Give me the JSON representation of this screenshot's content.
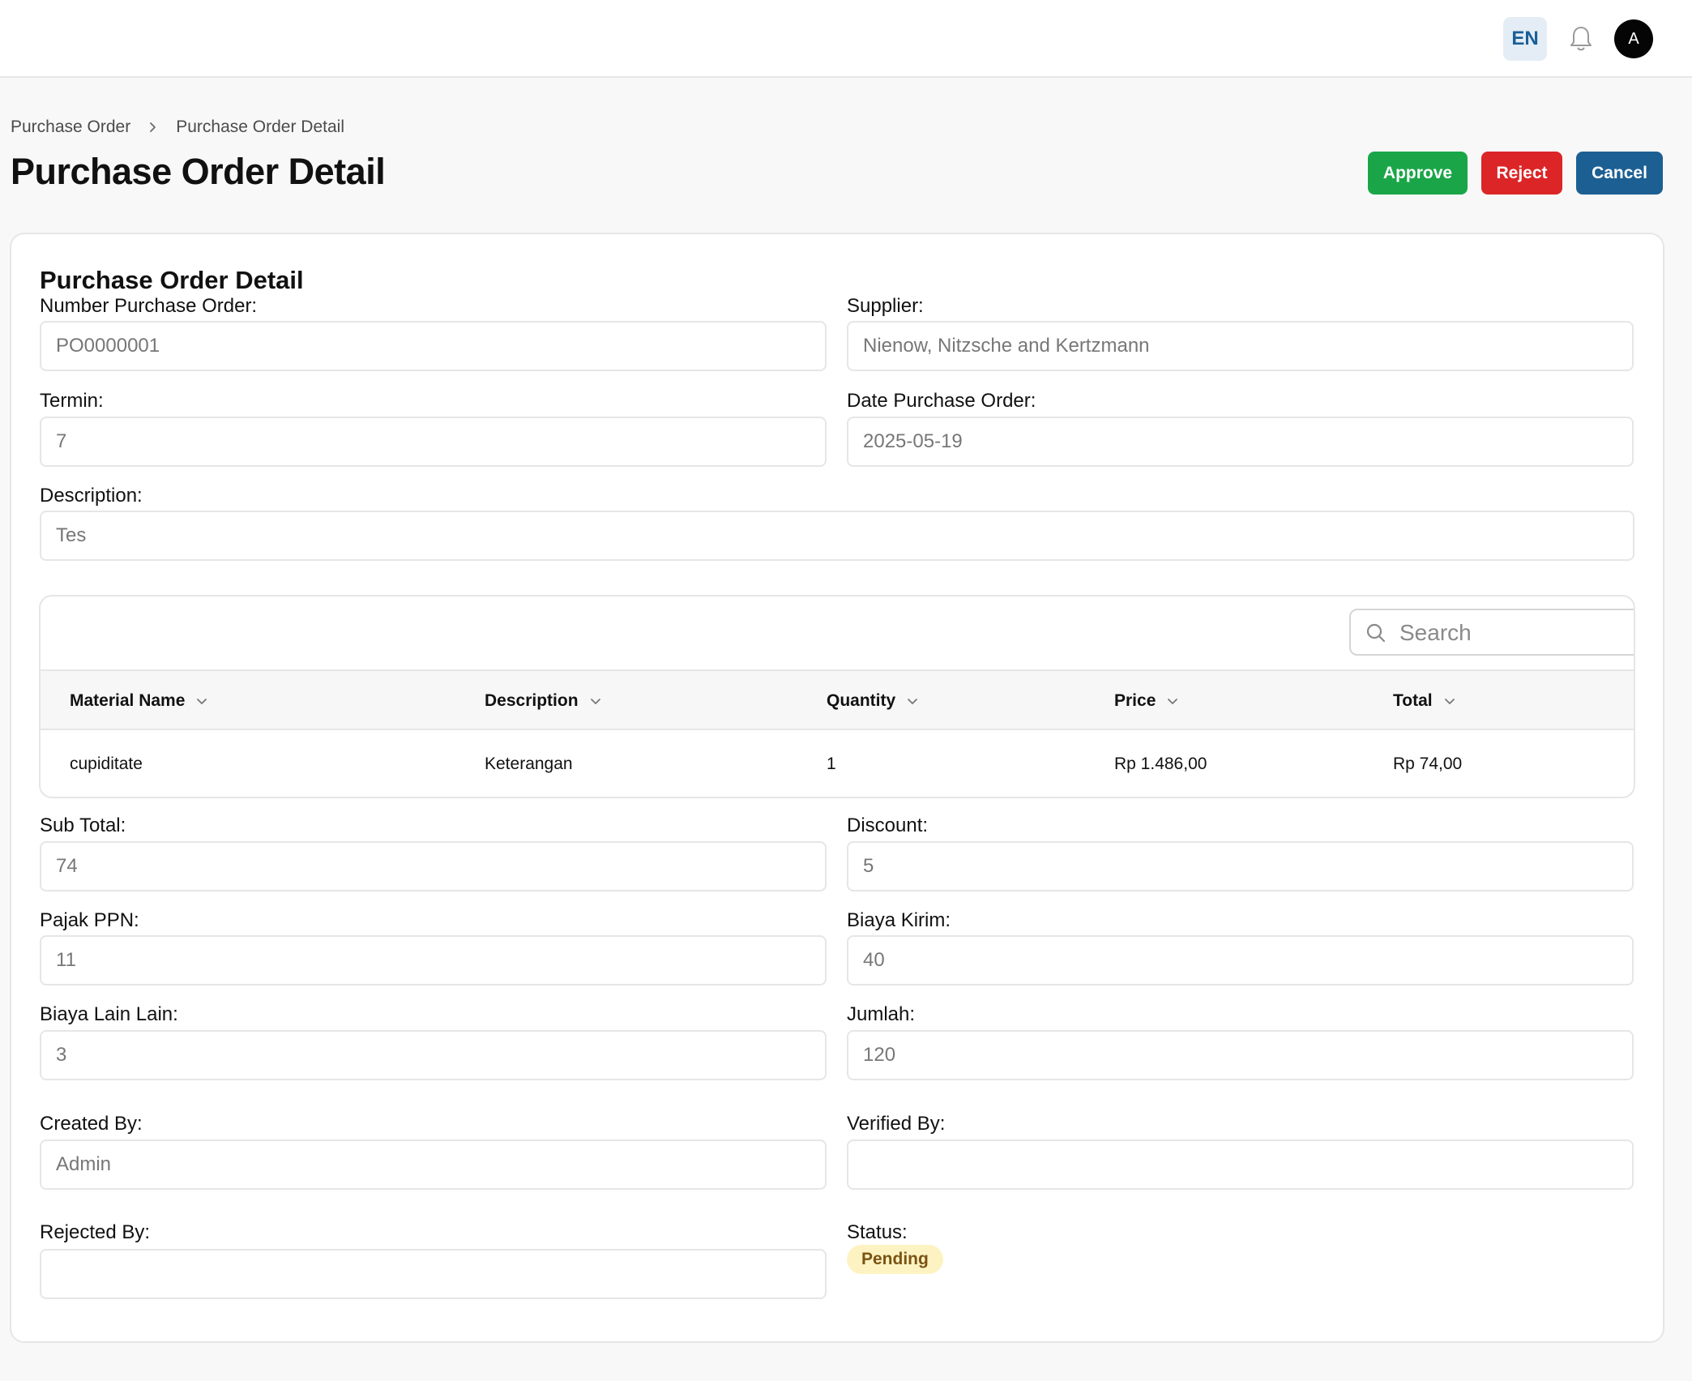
{
  "topbar": {
    "language": "EN",
    "avatar_initial": "A"
  },
  "breadcrumb": {
    "items": [
      "Purchase Order",
      "Purchase Order Detail"
    ]
  },
  "page_title": "Purchase Order Detail",
  "actions": {
    "approve": "Approve",
    "reject": "Reject",
    "cancel": "Cancel"
  },
  "colors": {
    "approve": "#1aa648",
    "reject": "#dc2527",
    "cancel": "#1c5f93",
    "lang_text": "#1a5f97",
    "status_bg": "#fdf3c2",
    "status_text": "#7a5314"
  },
  "form": {
    "section_title": "Purchase Order Detail",
    "number_po": {
      "label": "Number Purchase Order:",
      "value": "PO0000001"
    },
    "supplier": {
      "label": "Supplier:",
      "value": "Nienow, Nitzsche and Kertzmann"
    },
    "termin": {
      "label": "Termin:",
      "value": "7"
    },
    "date_po": {
      "label": "Date Purchase Order:",
      "value": "2025-05-19"
    },
    "description": {
      "label": "Description:",
      "value": "Tes"
    },
    "sub_total": {
      "label": "Sub Total:",
      "value": "74"
    },
    "discount": {
      "label": "Discount:",
      "value": "5"
    },
    "pajak_ppn": {
      "label": "Pajak PPN:",
      "value": "11"
    },
    "biaya_kirim": {
      "label": "Biaya Kirim:",
      "value": "40"
    },
    "biaya_lain": {
      "label": "Biaya Lain Lain:",
      "value": "3"
    },
    "jumlah": {
      "label": "Jumlah:",
      "value": "120"
    },
    "created_by": {
      "label": "Created By:",
      "value": "Admin"
    },
    "verified_by": {
      "label": "Verified By:",
      "value": ""
    },
    "rejected_by": {
      "label": "Rejected By:",
      "value": ""
    },
    "status": {
      "label": "Status:",
      "value": "Pending"
    }
  },
  "table": {
    "search_placeholder": "Search",
    "columns": [
      "Material Name",
      "Description",
      "Quantity",
      "Price",
      "Total"
    ],
    "rows": [
      [
        "cupiditate",
        "Keterangan",
        "1",
        "Rp 1.486,00",
        "Rp 74,00"
      ]
    ]
  }
}
